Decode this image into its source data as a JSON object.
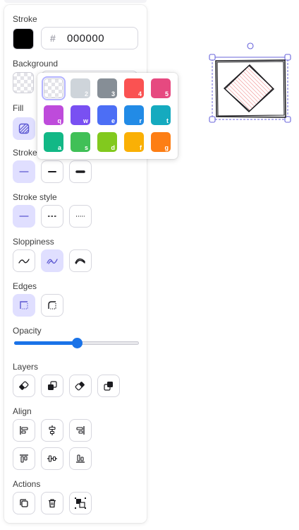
{
  "labels": {
    "stroke": "Stroke",
    "background": "Background",
    "fill": "Fill",
    "stroke_width": "Stroke width",
    "stroke_style": "Stroke style",
    "sloppiness": "Sloppiness",
    "edges": "Edges",
    "opacity": "Opacity",
    "layers": "Layers",
    "align": "Align",
    "actions": "Actions"
  },
  "stroke": {
    "hash": "#",
    "hex_value": "000000",
    "color": "#000000"
  },
  "opacity": {
    "value": 50,
    "min": 0,
    "max": 100
  },
  "palette": {
    "rows": [
      [
        {
          "key": "",
          "color": "transparent",
          "name": "transparent"
        },
        {
          "key": "2",
          "color": "#ced4da"
        },
        {
          "key": "3",
          "color": "#868e96"
        },
        {
          "key": "4",
          "color": "#fa5252"
        },
        {
          "key": "5",
          "color": "#e64980"
        }
      ],
      [
        {
          "key": "q",
          "color": "#be4bdb"
        },
        {
          "key": "w",
          "color": "#7950f2"
        },
        {
          "key": "e",
          "color": "#4c6ef5"
        },
        {
          "key": "r",
          "color": "#228be6"
        },
        {
          "key": "t",
          "color": "#15aabf"
        }
      ],
      [
        {
          "key": "a",
          "color": "#12b886"
        },
        {
          "key": "s",
          "color": "#40c057"
        },
        {
          "key": "d",
          "color": "#82c91e"
        },
        {
          "key": "f",
          "color": "#fab005"
        },
        {
          "key": "g",
          "color": "#fd7e14"
        }
      ]
    ]
  },
  "colors": {
    "accent": "#1a73e8",
    "active_bg": "#e0dfff",
    "active_icon": "#5b57d1",
    "selection": "#6965db",
    "shape_fill_hatch": "#f08c8c"
  },
  "icons": {
    "fill": "hachure-fill-icon",
    "stroke_width": [
      "thin-line-icon",
      "bold-line-icon",
      "extra-bold-line-icon"
    ],
    "stroke_style": [
      "solid-line-icon",
      "dashed-line-icon",
      "dotted-line-icon"
    ],
    "sloppiness": [
      "architect-icon",
      "artist-icon",
      "cartoonist-icon"
    ],
    "edges": [
      "sharp-edges-icon",
      "round-edges-icon"
    ],
    "layers": [
      "send-to-back-icon",
      "send-backward-icon",
      "bring-forward-icon",
      "bring-to-front-icon"
    ],
    "align": [
      "align-left-icon",
      "align-horizontal-center-icon",
      "align-right-icon",
      "align-top-icon",
      "align-vertical-center-icon",
      "align-bottom-icon"
    ],
    "actions": [
      "duplicate-icon",
      "delete-icon",
      "link-icon"
    ]
  }
}
